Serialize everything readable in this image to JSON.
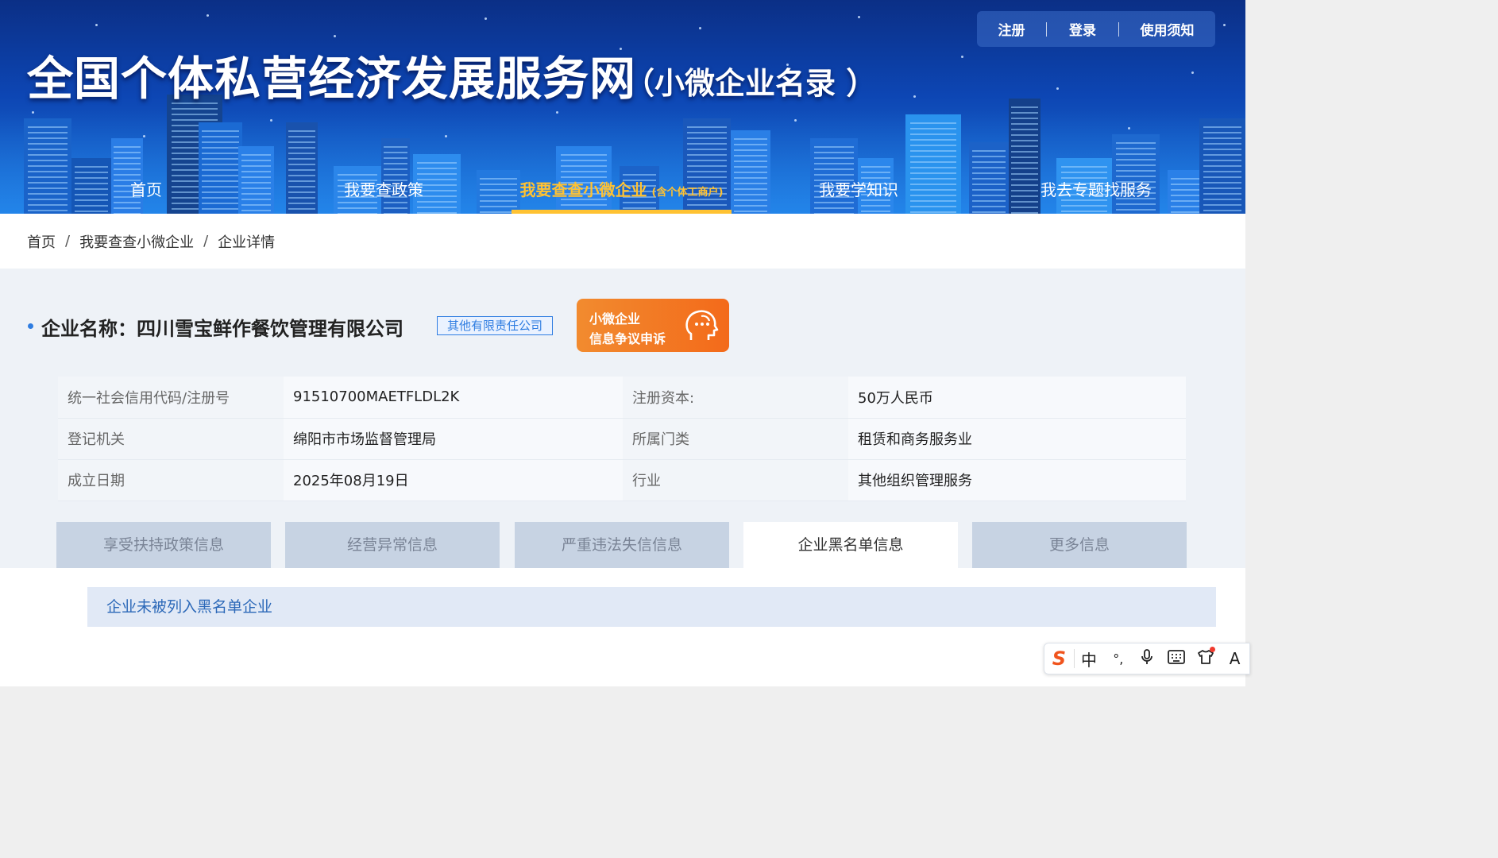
{
  "header": {
    "title": "全国个体私营经济发展服务网",
    "subtitle": "（小微企业名录 ）",
    "top_links": [
      "注册",
      "登录",
      "使用须知"
    ]
  },
  "nav": {
    "items": [
      "首页",
      "我要查政策",
      "我要查查小微企业",
      "我要学知识",
      "我去专题找服务"
    ],
    "active_tag": "(含个体工商户)",
    "active_index": 2
  },
  "breadcrumb": [
    "首页",
    "我要查查小微企业",
    "企业详情"
  ],
  "company": {
    "label": "企业名称：四川雪宝鲜作餐饮管理有限公司",
    "type": "其他有限责任公司",
    "appeal_line1": "小微企业",
    "appeal_line2": "信息争议申诉"
  },
  "info_rows": [
    {
      "k1": "统一社会信用代码/注册号",
      "v1": "91510700MAETFLDL2K",
      "k2": "注册资本:",
      "v2": "50万人民币"
    },
    {
      "k1": "登记机关",
      "v1": "绵阳市市场监督管理局",
      "k2": "所属门类",
      "v2": "租赁和商务服务业"
    },
    {
      "k1": "成立日期",
      "v1": "2025年08月19日",
      "k2": "行业",
      "v2": "其他组织管理服务"
    }
  ],
  "tabs": [
    "享受扶持政策信息",
    "经营异常信息",
    "严重违法失信信息",
    "企业黑名单信息",
    "更多信息"
  ],
  "active_tab": 3,
  "notice": "企业未被列入黑名单企业",
  "ime": {
    "logo": "S",
    "mode": "中",
    "punct": "°,",
    "icons": [
      "logo-icon",
      "chinese-mode-icon",
      "punctuation-icon",
      "microphone-icon",
      "keyboard-icon",
      "skin-icon",
      "more-icon"
    ],
    "extra": "A"
  },
  "colors": {
    "accent": "#ffc232",
    "link": "#2f7de1",
    "appeal": "#f36a1a",
    "hero": "#0d46b4"
  }
}
